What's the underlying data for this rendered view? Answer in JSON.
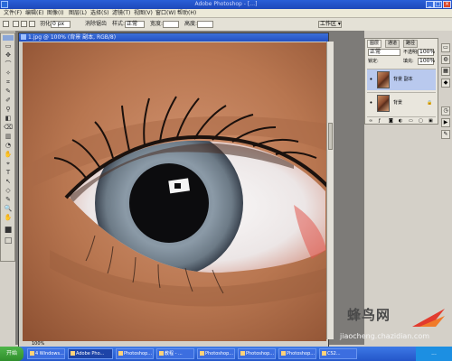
{
  "window": {
    "title": "Adobe Photoshop - […]",
    "buttons": [
      "_",
      "□",
      "×"
    ]
  },
  "menu": [
    "文件(F)",
    "编辑(E)",
    "图像(I)",
    "图层(L)",
    "选择(S)",
    "滤镜(T)",
    "视图(V)",
    "窗口(W)",
    "帮助(H)"
  ],
  "options_bar": {
    "feather_label": "羽化:",
    "feather_value": "0 px",
    "antialias_label": "消除锯齿",
    "style_label": "样式:",
    "style_value": "正常",
    "width_label": "宽度:",
    "height_label": "高度:",
    "workspace_label": "工作区 ▾"
  },
  "tools": [
    "▭",
    "✥",
    "⌒",
    "✧",
    "⌗",
    "✎",
    "✐",
    "⚲",
    "◧",
    "⌫",
    "▥",
    "◔",
    "✋",
    "⌖",
    "T",
    "↖",
    "◇",
    "✎",
    "🔍",
    "✋",
    "■",
    "□"
  ],
  "document": {
    "title": "1.jpg @ 100% (背景 副本, RGB/8)",
    "status": "100%"
  },
  "layers_panel": {
    "tabs": [
      "图层",
      "通道",
      "路径"
    ],
    "blend_mode": "正常",
    "opacity_label": "不透明度:",
    "opacity_value": "100%",
    "lock_label": "锁定:",
    "fill_label": "填充:",
    "fill_value": "100%",
    "layers": [
      {
        "name": "背景 副本",
        "visible": true,
        "selected": true
      },
      {
        "name": "背景",
        "visible": true,
        "selected": false,
        "locked": true
      }
    ],
    "footer_icons": [
      "link-icon",
      "fx-icon",
      "mask-icon",
      "adjust-icon",
      "folder-icon",
      "new-layer-icon",
      "trash-icon"
    ]
  },
  "taskbar": {
    "start_label": "开始",
    "items": [
      "4 Windows...",
      "Adobe Pho...",
      "Photoshop...",
      "教程 - ...",
      "Photoshop...",
      "Photoshop...",
      "Photoshop...",
      "CS2..."
    ],
    "tray_time": "..."
  },
  "watermark": {
    "brand": "蜂鸟网",
    "url": "jiaocheng.chazidian.com"
  }
}
